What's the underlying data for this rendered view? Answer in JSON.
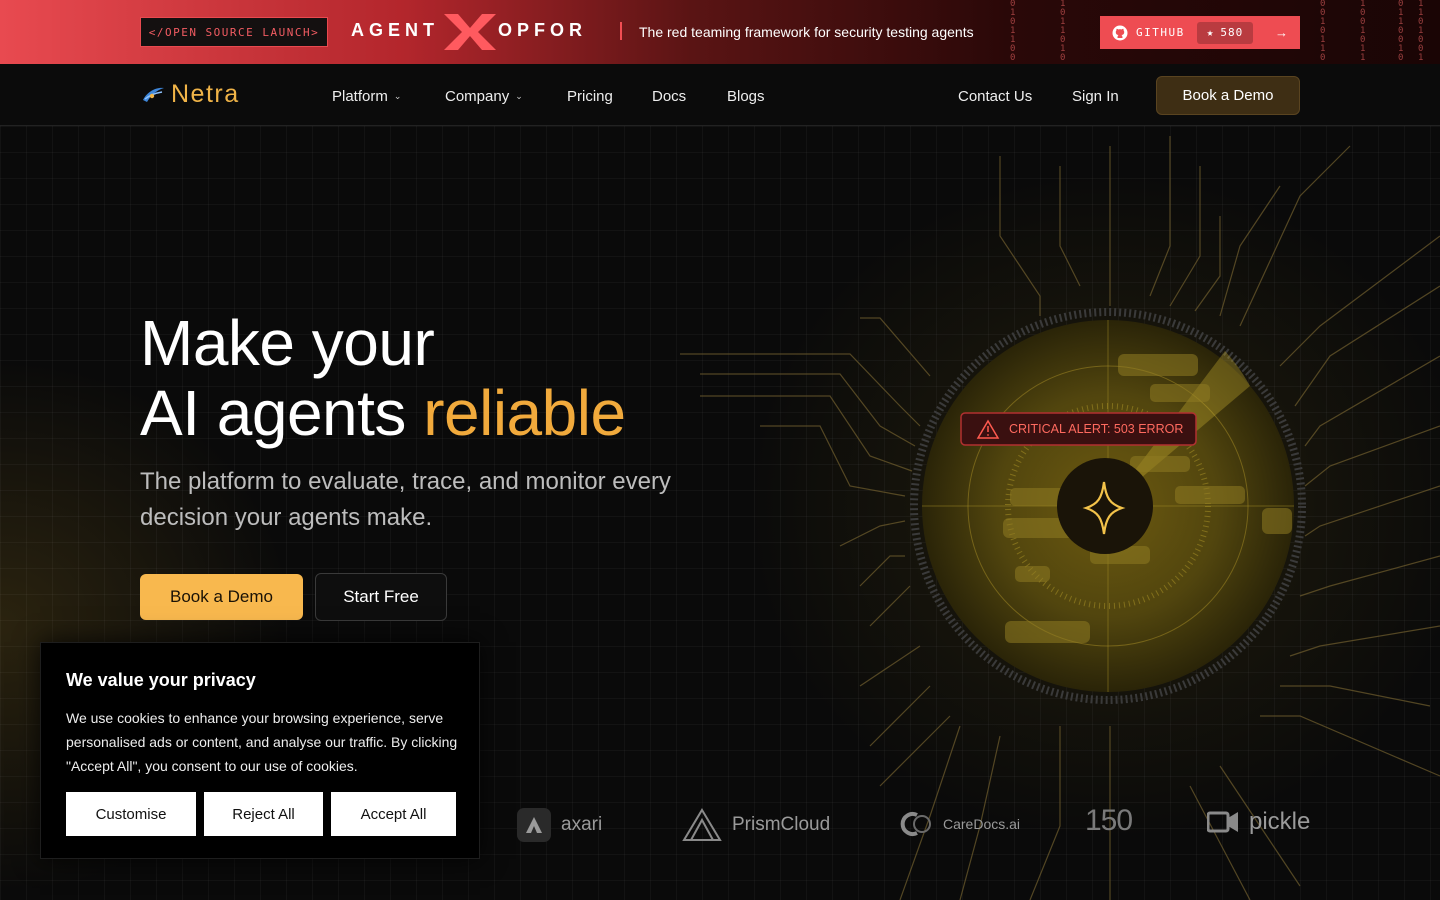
{
  "announcement": {
    "launch_tag": "</OPEN SOURCE LAUNCH>",
    "brand_left": "AGENT",
    "brand_right": "OPFOR",
    "tagline": "The red teaming framework for security testing agents",
    "github_label": "GITHUB",
    "github_stars": "580",
    "arrow": "→"
  },
  "nav": {
    "logo_text": "Netra",
    "items": [
      {
        "label": "Platform",
        "has_dropdown": true
      },
      {
        "label": "Company",
        "has_dropdown": true
      },
      {
        "label": "Pricing"
      },
      {
        "label": "Docs"
      },
      {
        "label": "Blogs"
      }
    ],
    "contact": "Contact Us",
    "signin": "Sign In",
    "demo": "Book a Demo"
  },
  "hero": {
    "headline_line1": "Make your",
    "headline_line2_plain": "AI agents ",
    "headline_line2_accent": "reliable",
    "subtitle": "The platform to evaluate, trace, and monitor every decision your agents make.",
    "primary_cta": "Book a Demo",
    "secondary_cta": "Start Free",
    "alert_text": "CRITICAL ALERT: 503 ERROR"
  },
  "customers": [
    "axari",
    "PrismCloud",
    "CareDocs.ai",
    "150",
    "pickle"
  ],
  "cookie": {
    "title": "We value your privacy",
    "body": "We use cookies to enhance your browsing experience, serve personalised ads or content, and analyse our traffic. By clicking \"Accept All\", you consent to our use of cookies.",
    "customise": "Customise",
    "reject": "Reject All",
    "accept": "Accept All"
  },
  "colors": {
    "accent_gold": "#f1aa3c",
    "button_gold": "#f8b84e",
    "announce_red": "#e84a50",
    "alert_red": "#ff5a4f"
  },
  "icons": [
    "github-icon",
    "star-icon",
    "arrow-right-icon",
    "netra-logo-icon",
    "chevron-down-icon",
    "warning-icon",
    "sparkle-icon"
  ]
}
